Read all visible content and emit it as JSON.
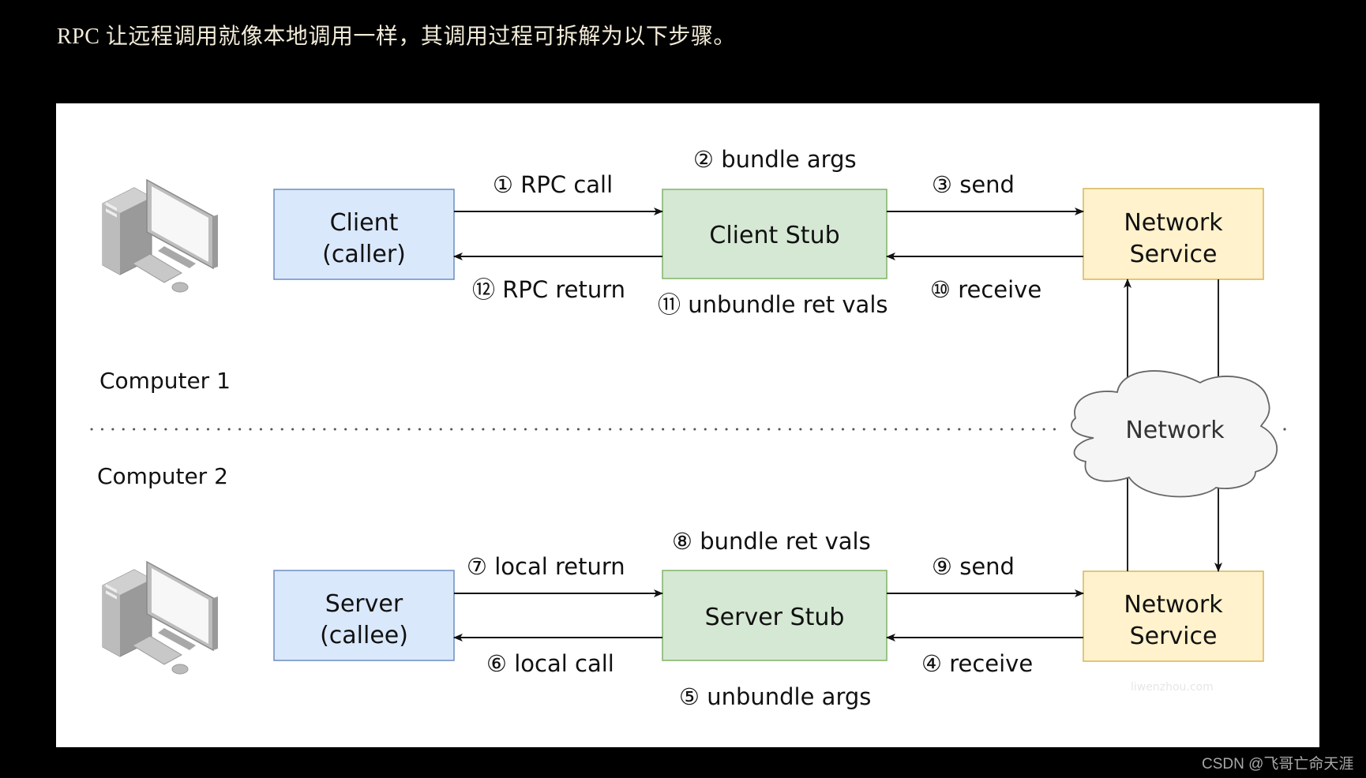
{
  "heading": "RPC 让远程调用就像本地调用一样，其调用过程可拆解为以下步骤。",
  "diagram": {
    "computers": {
      "top": {
        "label": "Computer 1",
        "icon": "desktop-computer-icon"
      },
      "bottom": {
        "label": "Computer 2",
        "icon": "desktop-computer-icon"
      }
    },
    "boxes": {
      "client": {
        "line1": "Client",
        "line2": "(caller)",
        "fill": "#dae8fc",
        "stroke": "#6c8ebf"
      },
      "client_stub": {
        "line1": "Client Stub",
        "fill": "#d5e8d4",
        "stroke": "#82b366"
      },
      "network_service_top": {
        "line1": "Network",
        "line2": "Service",
        "fill": "#fff2cc",
        "stroke": "#d6b656"
      },
      "server": {
        "line1": "Server",
        "line2": "(callee)",
        "fill": "#dae8fc",
        "stroke": "#6c8ebf"
      },
      "server_stub": {
        "line1": "Server Stub",
        "fill": "#d5e8d4",
        "stroke": "#82b366"
      },
      "network_service_bottom": {
        "line1": "Network",
        "line2": "Service",
        "fill": "#fff2cc",
        "stroke": "#d6b656"
      }
    },
    "cloud": {
      "label": "Network",
      "fill": "#f5f5f5",
      "stroke": "#666666"
    },
    "steps": {
      "s1": "① RPC call",
      "s2": "② bundle args",
      "s3": "③ send",
      "s4": "④ receive",
      "s5": "⑤ unbundle args",
      "s6": "⑥ local call",
      "s7": "⑦ local return",
      "s8": "⑧ bundle ret vals",
      "s9": "⑨ send",
      "s10": "⑩ receive",
      "s11": "⑪ unbundle ret vals",
      "s12": "⑫ RPC return"
    },
    "image_watermark": "liwenzhou.com"
  },
  "footer_watermark": "CSDN @飞哥亡命天涯"
}
